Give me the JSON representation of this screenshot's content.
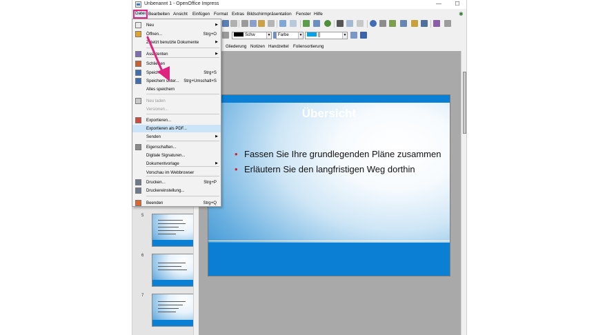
{
  "window": {
    "title": "Unbenannt 1 - OpenOffice Impress",
    "minimize_glyph": "—",
    "maximize_glyph": "☐"
  },
  "menubar": {
    "items": [
      "Datei",
      "Bearbeiten",
      "Ansicht",
      "Einfügen",
      "Format",
      "Extras",
      "Bildschirmpräsentation",
      "Fenster",
      "Hilfe"
    ],
    "active": "Datei"
  },
  "toolbar2": {
    "line_color_label": "Schw",
    "area_style_label": "Farbe",
    "area_color_label": "[]",
    "line_color": "#000000",
    "area_color": "#00a2e8"
  },
  "view_tabs": [
    "Gliederung",
    "Notizen",
    "Handzettel",
    "Foliensortierung"
  ],
  "file_menu": {
    "items": [
      {
        "label": "Neu",
        "icon": "new-document-icon",
        "submenu": true
      },
      {
        "label": "Öffnen...",
        "shortcut": "Strg+O",
        "icon": "open-folder-icon"
      },
      {
        "label": "Zuletzt benutzte Dokumente",
        "submenu": true
      },
      {
        "label": "Assistenten",
        "icon": "wizard-icon",
        "submenu": true
      },
      {
        "label": "Schließen",
        "icon": "close-document-icon"
      },
      {
        "label": "Speichern",
        "shortcut": "Strg+S",
        "icon": "save-icon"
      },
      {
        "label": "Speichern unter...",
        "shortcut": "Strg+Umschalt+S",
        "icon": "save-as-icon"
      },
      {
        "label": "Alles speichern"
      },
      {
        "label": "Neu laden",
        "disabled": true,
        "icon": "reload-icon"
      },
      {
        "label": "Versionen...",
        "disabled": true
      },
      {
        "label": "Exportieren...",
        "icon": "export-icon"
      },
      {
        "label": "Exportieren als PDF...",
        "highlighted": true
      },
      {
        "label": "Senden",
        "submenu": true
      },
      {
        "label": "Eigenschaften...",
        "icon": "properties-icon"
      },
      {
        "label": "Digitale Signaturen..."
      },
      {
        "label": "Dokumentvorlage",
        "submenu": true
      },
      {
        "label": "Vorschau im Webbrowser"
      },
      {
        "label": "Drucken...",
        "shortcut": "Strg+P",
        "icon": "print-icon"
      },
      {
        "label": "Druckereinstellung...",
        "icon": "printer-settings-icon"
      },
      {
        "label": "Beenden",
        "shortcut": "Strg+Q",
        "icon": "exit-icon"
      }
    ]
  },
  "slide_panel": {
    "thumbnails": [
      {
        "number": "5",
        "lines": 5
      },
      {
        "number": "6",
        "lines": 3
      },
      {
        "number": "7",
        "lines": 4
      }
    ]
  },
  "slide": {
    "title": "Übersicht",
    "bullets": [
      "Fassen Sie Ihre grundlegenden Pläne zusammen",
      "Erläutern Sie den langfristigen Weg dorthin"
    ],
    "bullet_glyph": "•",
    "bullet_color": "#d0202e",
    "accent_color": "#0a7fd3"
  },
  "annotation": {
    "highlight_color": "#e0237e"
  }
}
